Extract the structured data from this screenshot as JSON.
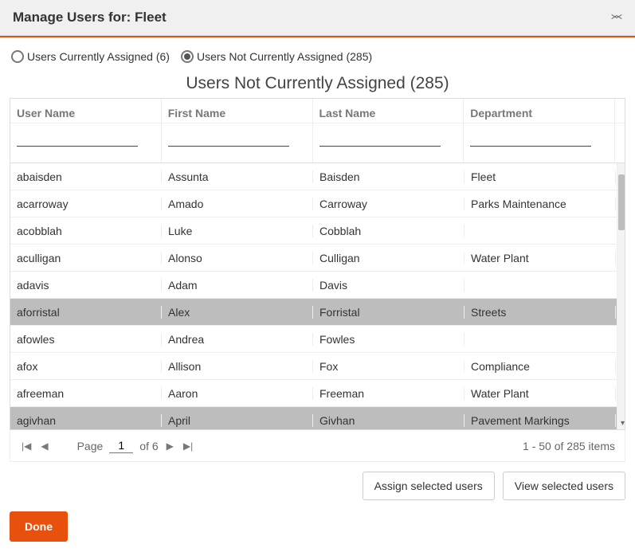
{
  "header": {
    "title": "Manage Users for: Fleet"
  },
  "radios": {
    "assigned": {
      "label": "Users Currently Assigned (6)",
      "checked": false
    },
    "not_assigned": {
      "label": "Users Not Currently Assigned (285)",
      "checked": true
    }
  },
  "section_title": "Users Not Currently Assigned (285)",
  "columns": {
    "c1": "User Name",
    "c2": "First Name",
    "c3": "Last Name",
    "c4": "Department"
  },
  "filters": {
    "c1": "",
    "c2": "",
    "c3": "",
    "c4": ""
  },
  "rows": [
    {
      "username": "abaisden",
      "first": "Assunta",
      "last": "Baisden",
      "dept": "Fleet",
      "selected": false
    },
    {
      "username": "acarroway",
      "first": "Amado",
      "last": "Carroway",
      "dept": "Parks Maintenance",
      "selected": false
    },
    {
      "username": "acobblah",
      "first": "Luke",
      "last": "Cobblah",
      "dept": "",
      "selected": false
    },
    {
      "username": "aculligan",
      "first": "Alonso",
      "last": "Culligan",
      "dept": "Water Plant",
      "selected": false
    },
    {
      "username": "adavis",
      "first": "Adam",
      "last": "Davis",
      "dept": "",
      "selected": false
    },
    {
      "username": "aforristal",
      "first": "Alex",
      "last": "Forristal",
      "dept": "Streets",
      "selected": true
    },
    {
      "username": "afowles",
      "first": "Andrea",
      "last": "Fowles",
      "dept": "",
      "selected": false
    },
    {
      "username": "afox",
      "first": "Allison",
      "last": "Fox",
      "dept": "Compliance",
      "selected": false
    },
    {
      "username": "afreeman",
      "first": "Aaron",
      "last": "Freeman",
      "dept": "Water Plant",
      "selected": false
    },
    {
      "username": "agivhan",
      "first": "April",
      "last": "Givhan",
      "dept": "Pavement Markings",
      "selected": true
    }
  ],
  "pager": {
    "page_label": "Page",
    "page": "1",
    "of_label": "of 6",
    "summary": "1 - 50 of 285 items"
  },
  "actions": {
    "assign": "Assign selected users",
    "view": "View selected users",
    "done": "Done"
  }
}
